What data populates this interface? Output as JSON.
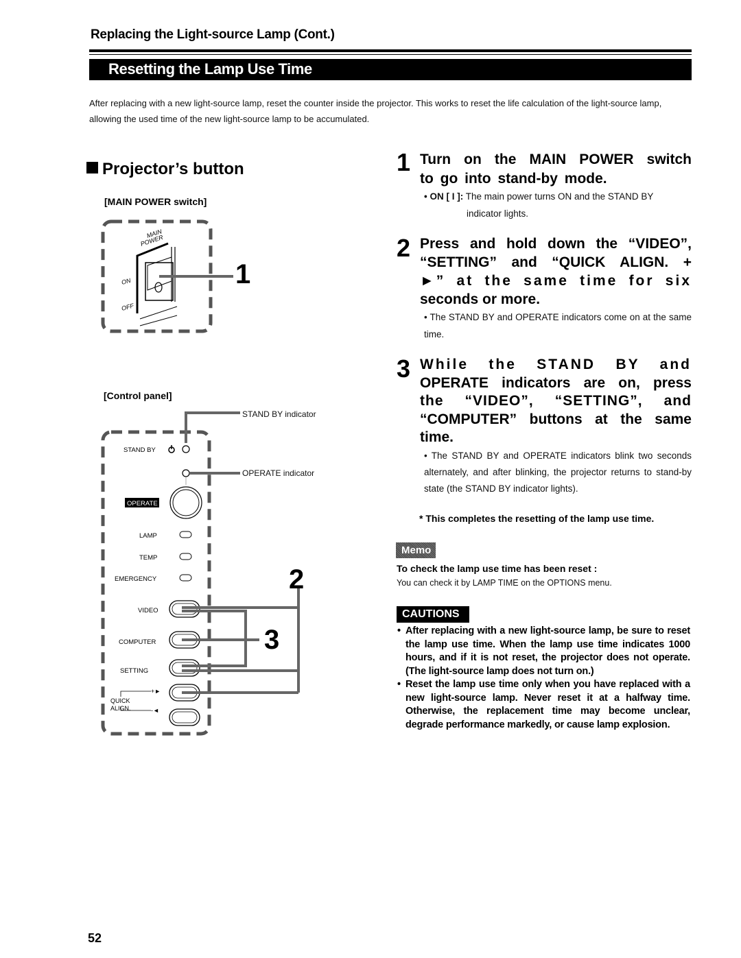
{
  "header": {
    "section_title": "Replacing the Light-source Lamp (Cont.)",
    "banner_title": "Resetting the Lamp Use Time"
  },
  "intro": "After replacing with a new light-source lamp, reset the counter inside the projector. This works to reset the life calculation of the light-source lamp, allowing the used time of the new light-source lamp to be accumulated.",
  "left": {
    "heading": "Projector’s button",
    "main_power_label": "[MAIN POWER switch]",
    "switch_text": {
      "main": "MAIN",
      "power": "POWER",
      "on": "ON",
      "off": "OFF"
    },
    "callout_1": "1",
    "control_panel_label": "[Control panel]",
    "standby_indicator_label": "STAND BY indicator",
    "operate_indicator_label": "OPERATE indicator",
    "panel": {
      "stand_by": "STAND BY",
      "operate": "OPERATE",
      "lamp": "LAMP",
      "temp": "TEMP",
      "emergency": "EMERGENCY",
      "video": "VIDEO",
      "computer": "COMPUTER",
      "setting": "SETTING",
      "quick": "QUICK",
      "align": "ALIGN.",
      "plus": "+►",
      "minus": "-◄"
    },
    "callout_2": "2",
    "callout_3": "3"
  },
  "steps": [
    {
      "number": "1",
      "title_lines": [
        "Turn on the MAIN POWER switch",
        "to go into stand-by mode."
      ],
      "note_label": "• ON [ I ]:",
      "note": "The main power turns ON and the STAND BY",
      "note_cont": "indicator lights."
    },
    {
      "number": "2",
      "title_lines": [
        "Press and hold down the “VIDEO”,",
        "“SETTING” and “QUICK ALIGN. +",
        "►” at the same time for six",
        "seconds or more."
      ],
      "note": "• The STAND BY and OPERATE indicators come on at the same time."
    },
    {
      "number": "3",
      "title_lines": [
        "While the STAND BY and",
        "OPERATE indicators are on, press",
        "the “VIDEO”, “SETTING”, and",
        "“COMPUTER” buttons at the same",
        "time."
      ],
      "note": "• The STAND BY and OPERATE indicators blink two seconds alternately, and after blinking, the projector returns to stand-by state (the STAND BY indicator lights)."
    }
  ],
  "completes": "* This completes the resetting of the lamp use time.",
  "memo": {
    "badge": "Memo",
    "title": "To check the lamp use time has been reset :",
    "text": "You can check it by LAMP TIME on the OPTIONS menu."
  },
  "cautions": {
    "badge": "CAUTIONS",
    "items": [
      "After replacing with a new light-source lamp, be sure to reset the lamp use time. When the lamp use time indicates 1000 hours, and if it is not reset, the projector does not operate. (The light-source lamp does not turn on.)",
      "Reset the lamp use time only when you have replaced with a new light-source lamp. Never reset it at a halfway time. Otherwise, the replacement time may become unclear, degrade performance markedly, or cause lamp explosion."
    ]
  },
  "page_number": "52"
}
